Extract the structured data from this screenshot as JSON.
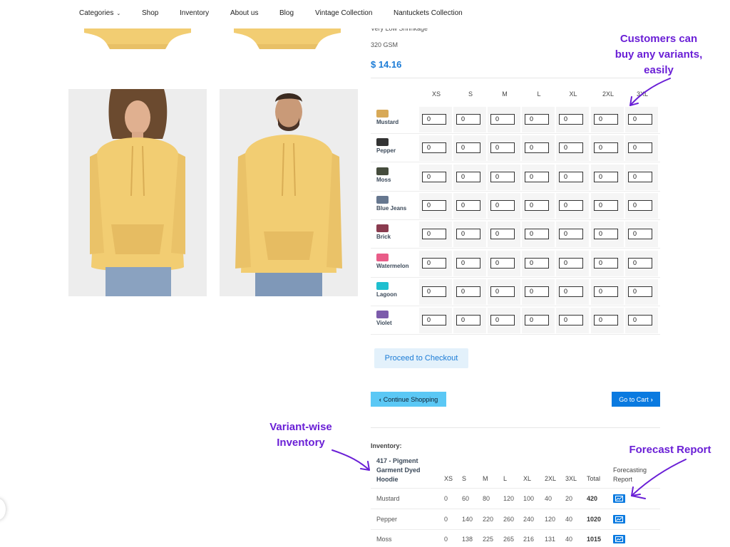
{
  "nav": {
    "items": [
      {
        "label": "Categories",
        "caret": "⌄"
      },
      {
        "label": "Shop"
      },
      {
        "label": "Inventory"
      },
      {
        "label": "About us"
      },
      {
        "label": "Blog"
      },
      {
        "label": "Vintage Collection"
      },
      {
        "label": "Nantuckets Collection"
      }
    ]
  },
  "product": {
    "specs": [
      "Very Low Shrinkage",
      "320 GSM"
    ],
    "price": "$ 14.16"
  },
  "variants": {
    "sizes": [
      "XS",
      "S",
      "M",
      "L",
      "XL",
      "2XL",
      "3XL"
    ],
    "colors": [
      {
        "name": "Mustard",
        "swatch": "#d8a957",
        "qty": [
          "0",
          "0",
          "0",
          "0",
          "0",
          "0",
          "0"
        ]
      },
      {
        "name": "Pepper",
        "swatch": "#333333",
        "qty": [
          "0",
          "0",
          "0",
          "0",
          "0",
          "0",
          "0"
        ]
      },
      {
        "name": "Moss",
        "swatch": "#454c3c",
        "qty": [
          "0",
          "0",
          "0",
          "0",
          "0",
          "0",
          "0"
        ]
      },
      {
        "name": "Blue Jeans",
        "swatch": "#66778f",
        "qty": [
          "0",
          "0",
          "0",
          "0",
          "0",
          "0",
          "0"
        ]
      },
      {
        "name": "Brick",
        "swatch": "#8a3b4f",
        "qty": [
          "0",
          "0",
          "0",
          "0",
          "0",
          "0",
          "0"
        ]
      },
      {
        "name": "Watermelon",
        "swatch": "#e95c88",
        "qty": [
          "0",
          "0",
          "0",
          "0",
          "0",
          "0",
          "0"
        ]
      },
      {
        "name": "Lagoon",
        "swatch": "#1fbfcf",
        "qty": [
          "0",
          "0",
          "0",
          "0",
          "0",
          "0",
          "0"
        ]
      },
      {
        "name": "Violet",
        "swatch": "#7c5bab",
        "qty": [
          "0",
          "0",
          "0",
          "0",
          "0",
          "0",
          "0"
        ]
      }
    ]
  },
  "buttons": {
    "checkout": "Proceed to Checkout",
    "continue": "Continue Shopping",
    "cart": "Go to Cart"
  },
  "inventory": {
    "label": "Inventory:",
    "product_name": "417 - Pigment Garment Dyed Hoodie",
    "headers": [
      "XS",
      "S",
      "M",
      "L",
      "XL",
      "2XL",
      "3XL",
      "Total"
    ],
    "forecast_header": "Forecasting Report",
    "rows": [
      {
        "color": "Mustard",
        "values": [
          "0",
          "60",
          "80",
          "120",
          "100",
          "40",
          "20"
        ],
        "total": "420"
      },
      {
        "color": "Pepper",
        "values": [
          "0",
          "140",
          "220",
          "260",
          "240",
          "120",
          "40"
        ],
        "total": "1020"
      },
      {
        "color": "Moss",
        "values": [
          "0",
          "138",
          "225",
          "265",
          "216",
          "131",
          "40"
        ],
        "total": "1015"
      }
    ]
  },
  "annotations": {
    "variants": "Customers can buy any variants, easily",
    "inventory": "Variant-wise Inventory",
    "forecast": "Forecast Report"
  },
  "colors": {
    "accent": "#1a7bd6",
    "annotation": "#6a1fd6",
    "hoodie": "#f2cd72"
  }
}
